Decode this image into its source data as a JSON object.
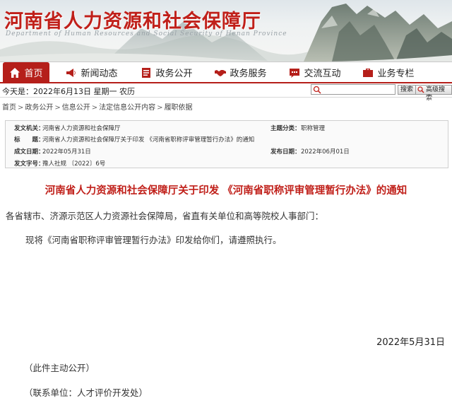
{
  "header": {
    "site_title": "河南省人力资源和社会保障厅",
    "site_subtitle": "Department of Human Resources and Social Security of Henan Province"
  },
  "nav": {
    "items": [
      {
        "label": "首页",
        "icon": "home-icon",
        "active": true
      },
      {
        "label": "新闻动态",
        "icon": "megaphone-icon",
        "active": false
      },
      {
        "label": "政务公开",
        "icon": "document-icon",
        "active": false
      },
      {
        "label": "政务服务",
        "icon": "handshake-icon",
        "active": false
      },
      {
        "label": "交流互动",
        "icon": "chat-icon",
        "active": false
      },
      {
        "label": "业务专栏",
        "icon": "briefcase-icon",
        "active": false
      }
    ],
    "active_color": "#b51f1a"
  },
  "datebar": {
    "date_text": "今天是：2022年6月13日 星期一    农历",
    "search_placeholder": "",
    "search_button": "搜索",
    "advanced_search_button": "高级搜索"
  },
  "breadcrumb": {
    "items": [
      "首页",
      "政务公开",
      "信息公开",
      "法定信息公开内容",
      "履职依据"
    ],
    "separator": ">"
  },
  "doc_info": {
    "issuer_label": "发文机关：",
    "issuer": "河南省人力资源和社会保障厅",
    "topic_label": "主题分类：",
    "topic": "职称管理",
    "title_label": "标　　题：",
    "title": "河南省人力资源和社会保障厅关于印发 《河南省职称评审管理暂行办法》的通知",
    "created_label": "成文日期：",
    "created": "2022年05月31日",
    "published_label": "发布日期：",
    "published": "2022年06月01日",
    "number_label": "发文字号：",
    "number": "豫人社规 〔2022〕6号"
  },
  "article": {
    "title": "河南省人力资源和社会保障厅关于印发 《河南省职称评审管理暂行办法》的通知",
    "salutation": "各省辖市、济源示范区人力资源社会保障局，省直有关单位和高等院校人事部门：",
    "body": "现将《河南省职称评审管理暂行办法》印发给你们，请遵照执行。",
    "sign_date": "2022年5月31日",
    "note_public": "（此件主动公开）",
    "note_contact": "（联系单位：人才评价开发处）",
    "title_color": "#c0201a"
  }
}
